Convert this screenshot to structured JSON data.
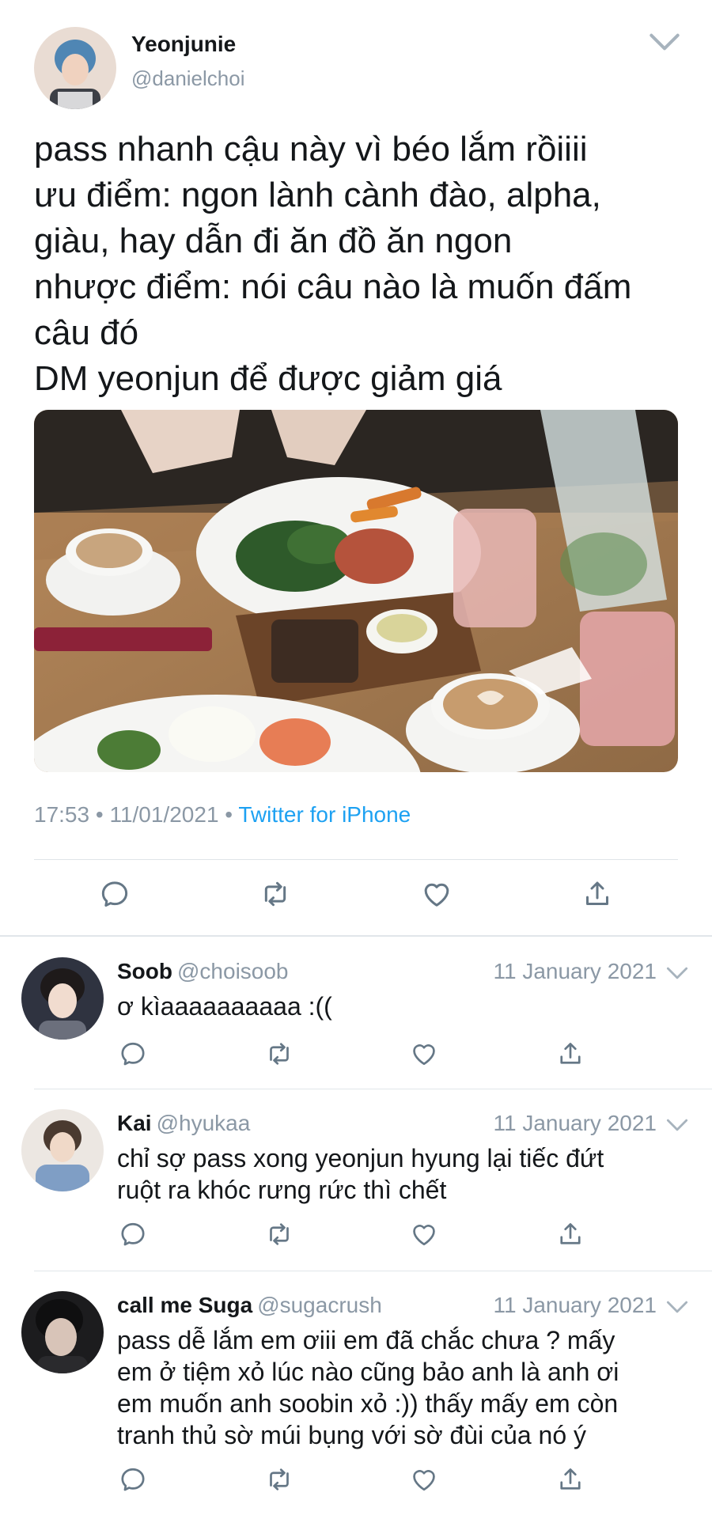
{
  "main_tweet": {
    "name": "Yeonjunie",
    "handle": "@danielchoi",
    "text_lines": [
      "pass nhanh cậu này vì béo lắm rồiiii",
      "ưu điểm: ngon lành cành đào, alpha,",
      "giàu, hay dẫn đi ăn đồ ăn ngon",
      "nhược điểm: nói câu nào là muốn đấm",
      "câu đó",
      "DM yeonjun để được giảm giá"
    ],
    "time": "17:53",
    "date": "11/01/2021",
    "source": "Twitter for iPhone"
  },
  "replies": [
    {
      "name": "Soob",
      "handle": "@choisoob",
      "date": "11 January 2021",
      "text_lines": [
        "ơ kìaaaaaaaaaa :(("
      ]
    },
    {
      "name": "Kai",
      "handle": "@hyukaa",
      "date": "11 January 2021",
      "text_lines": [
        "chỉ sợ pass xong yeonjun hyung lại tiếc đứt",
        "ruột ra khóc rưng rức thì chết"
      ]
    },
    {
      "name": "call me Suga",
      "handle": "@sugacrush",
      "date": "11 January 2021",
      "text_lines": [
        "pass dễ lắm em ơiii em đã chắc chưa ? mấy",
        "em ở tiệm xỏ lúc nào cũng bảo anh là anh ơi",
        "em muốn anh soobin xỏ :)) thấy mấy em còn",
        "tranh thủ sờ múi bụng với sờ đùi của nó ý"
      ]
    }
  ],
  "colors": {
    "accent": "#1da1f2",
    "secondary_text": "#8b98a5",
    "icon": "#657786",
    "divider": "#e1e6ea"
  },
  "icons": [
    "chevron-down-icon",
    "reply-icon",
    "retweet-icon",
    "like-icon",
    "share-icon"
  ]
}
